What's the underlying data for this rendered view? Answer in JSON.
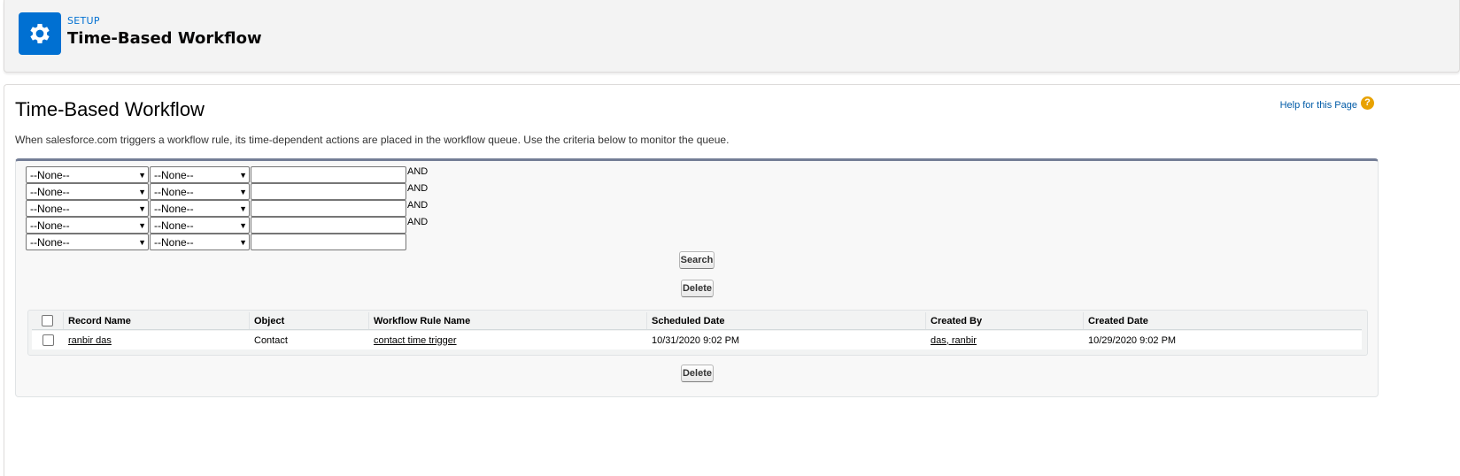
{
  "header": {
    "kicker": "SETUP",
    "title": "Time-Based Workflow",
    "icon": "gear-icon",
    "icon_color": "#0070d2"
  },
  "page": {
    "title": "Time-Based Workflow",
    "help_link": "Help for this Page",
    "help_icon": "?",
    "intro": "When salesforce.com triggers a workflow rule, its time-dependent actions are placed in the workflow queue. Use the criteria below to monitor the queue."
  },
  "filters": [
    {
      "field": "--None--",
      "operator": "--None--",
      "value": "",
      "conjunction": "AND"
    },
    {
      "field": "--None--",
      "operator": "--None--",
      "value": "",
      "conjunction": "AND"
    },
    {
      "field": "--None--",
      "operator": "--None--",
      "value": "",
      "conjunction": "AND"
    },
    {
      "field": "--None--",
      "operator": "--None--",
      "value": "",
      "conjunction": "AND"
    },
    {
      "field": "--None--",
      "operator": "--None--",
      "value": "",
      "conjunction": ""
    }
  ],
  "buttons": {
    "search": "Search",
    "delete_top": "Delete",
    "delete_bottom": "Delete"
  },
  "table": {
    "columns": [
      "Record Name",
      "Object",
      "Workflow Rule Name",
      "Scheduled Date",
      "Created By",
      "Created Date"
    ],
    "rows": [
      {
        "record_name": "ranbir das",
        "object": "Contact",
        "workflow_rule_name": "contact time trigger",
        "scheduled_date": "10/31/2020 9:02 PM",
        "created_by": "das, ranbir",
        "created_date": "10/29/2020 9:02 PM"
      }
    ]
  }
}
